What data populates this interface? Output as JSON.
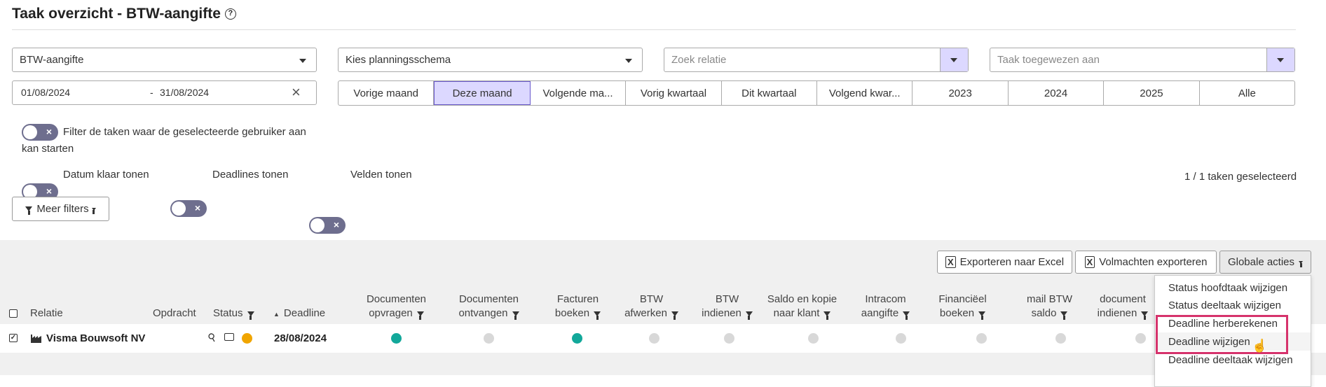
{
  "page": {
    "title": "Taak overzicht - BTW-aangifte"
  },
  "filters": {
    "task_type": "BTW-aangifte",
    "schedule_placeholder": "Kies planningsschema",
    "relation_placeholder": "Zoek relatie",
    "assignee_placeholder": "Taak toegewezen aan",
    "date_from": "01/08/2024",
    "date_sep": "-",
    "date_to": "31/08/2024",
    "periods": [
      "Vorige maand",
      "Deze maand",
      "Volgende ma...",
      "Vorig kwartaal",
      "Dit kwartaal",
      "Volgend kwar...",
      "2023",
      "2024",
      "2025",
      "Alle"
    ],
    "active_period": "Deze maand",
    "toggle_user_line1": "Filter de taken waar de geselecteerde gebruiker aan",
    "toggle_user_line2": "kan starten",
    "toggle_done": "Datum klaar tonen",
    "toggle_deadlines": "Deadlines tonen",
    "toggle_fields": "Velden tonen",
    "more_filters": "Meer filters",
    "selection_count": "1 / 1 taken geselecteerd"
  },
  "actions": {
    "export_excel": "Exporteren naar Excel",
    "export_proxies": "Volmachten exporteren",
    "global_actions": "Globale acties"
  },
  "table": {
    "headers": {
      "relation": "Relatie",
      "assignment": "Opdracht",
      "status": "Status",
      "deadline": "Deadline",
      "c1a": "Documenten",
      "c1b": "opvragen",
      "c2a": "Documenten",
      "c2b": "ontvangen",
      "c3a": "Facturen",
      "c3b": "boeken",
      "c4a": "BTW",
      "c4b": "afwerken",
      "c5a": "BTW",
      "c5b": "indienen",
      "c6a": "Saldo en kopie",
      "c6b": "naar klant",
      "c7a": "Intracom",
      "c7b": "aangifte",
      "c8a": "Financiëel",
      "c8b": "boeken",
      "c9a": "mail BTW",
      "c9b": "saldo",
      "c10a": "document",
      "c10b": "indienen"
    },
    "row": {
      "relation": "Visma Bouwsoft NV",
      "deadline": "28/08/2024",
      "status_color": "#f0a500",
      "step_states": [
        "done",
        "pending",
        "done",
        "pending",
        "pending",
        "pending",
        "pending",
        "pending",
        "pending",
        "pending"
      ]
    }
  },
  "global_menu": {
    "items": [
      "Status hoofdtaak wijzigen",
      "Status deeltaak wijzigen",
      "Deadline herberekenen",
      "Deadline wijzigen",
      "Deadline deeltaak wijzigen"
    ]
  },
  "colors": {
    "accent": "#dcd8ff",
    "teal": "#12a89a",
    "orange": "#f0a500",
    "highlight": "#d6336c"
  }
}
